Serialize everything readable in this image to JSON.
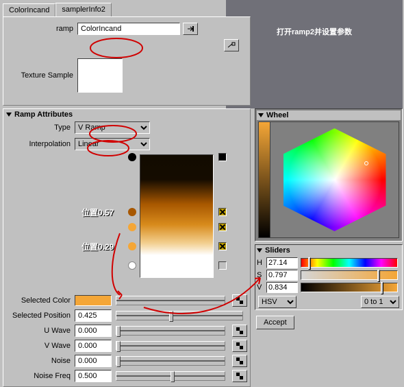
{
  "overlay": {
    "text": "打开ramp2并设置参数"
  },
  "tabs": {
    "items": [
      {
        "label": "ColorIncand"
      },
      {
        "label": "samplerInfo2"
      }
    ],
    "active": 0
  },
  "ramp_field": {
    "label": "ramp",
    "value": "ColorIncand"
  },
  "texture_sample": {
    "label": "Texture Sample"
  },
  "ramp_attrs": {
    "title": "Ramp Attributes",
    "type": {
      "label": "Type",
      "value": "V Ramp"
    },
    "interp": {
      "label": "Interpolation",
      "value": "Linear"
    }
  },
  "ramp_handles": {
    "top": {
      "color": "#000000",
      "pos": 0.0
    },
    "h1": {
      "color": "#a75700",
      "pos": 0.57,
      "label": "位置0.57"
    },
    "h2": {
      "color": "#f4a637",
      "pos": 0.29,
      "label": "位置0.29"
    },
    "h3": {
      "color": "#f4a637",
      "pos": 0.425
    },
    "bottom": {
      "color": "#ffffff",
      "pos": 1.0
    }
  },
  "selected": {
    "color": {
      "label": "Selected Color",
      "swatch": "#f4a637"
    },
    "position": {
      "label": "Selected Position",
      "value": "0.425"
    },
    "uwave": {
      "label": "U Wave",
      "value": "0.000"
    },
    "vwave": {
      "label": "V Wave",
      "value": "0.000"
    },
    "noise": {
      "label": "Noise",
      "value": "0.000"
    },
    "noisefreq": {
      "label": "Noise Freq",
      "value": "0.500"
    }
  },
  "wheel": {
    "title": "Wheel"
  },
  "sliders": {
    "title": "Sliders",
    "h": {
      "label": "H",
      "value": "27.14"
    },
    "s": {
      "label": "S",
      "value": "0.797"
    },
    "v": {
      "label": "V",
      "value": "0.834"
    },
    "mode": {
      "value": "HSV"
    },
    "range": {
      "value": "0 to 1"
    }
  },
  "accept": {
    "label": "Accept"
  },
  "chart_data": {
    "type": "ramp-gradient",
    "direction": "V",
    "interpolation": "Linear",
    "stops": [
      {
        "position": 0.0,
        "color": "#000000"
      },
      {
        "position": 0.29,
        "color": "#f4a637"
      },
      {
        "position": 0.425,
        "color": "#f4a637"
      },
      {
        "position": 0.57,
        "color": "#a75700"
      },
      {
        "position": 1.0,
        "color": "#ffffff"
      }
    ],
    "selected_stop": {
      "position": 0.425,
      "hsv": {
        "h": 27.14,
        "s": 0.797,
        "v": 0.834
      }
    }
  }
}
